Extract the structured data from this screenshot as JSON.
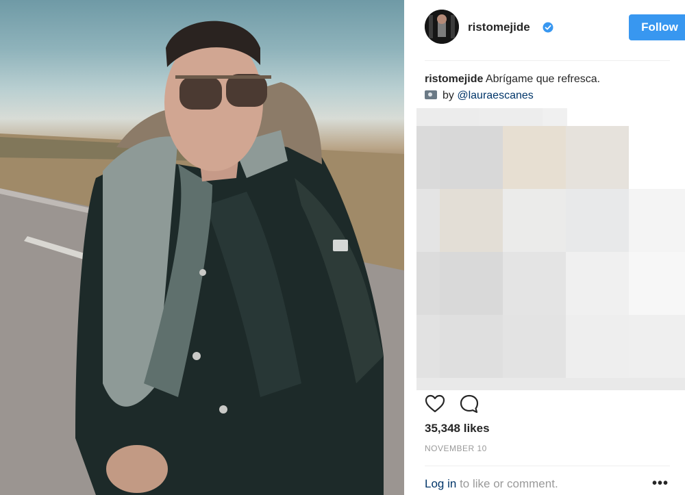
{
  "post": {
    "photo_alt": "Man in sunglasses and dark leather puffer jacket on a road",
    "username": "ristomejide",
    "verified_icon": "verified-badge-icon",
    "follow_label": "Follow",
    "caption_user": "ristomejide",
    "caption_text": "Abrígame que refresca.",
    "credit_prefix": "by",
    "credit_mention": "@lauraescanes",
    "likes": "35,348 likes",
    "date": "NOVEMBER 10",
    "login_link": "Log in",
    "login_rest": "to like or comment.",
    "more_label": "•••"
  },
  "colors": {
    "accent": "#3897f0",
    "link": "#003569",
    "muted": "#999999"
  }
}
